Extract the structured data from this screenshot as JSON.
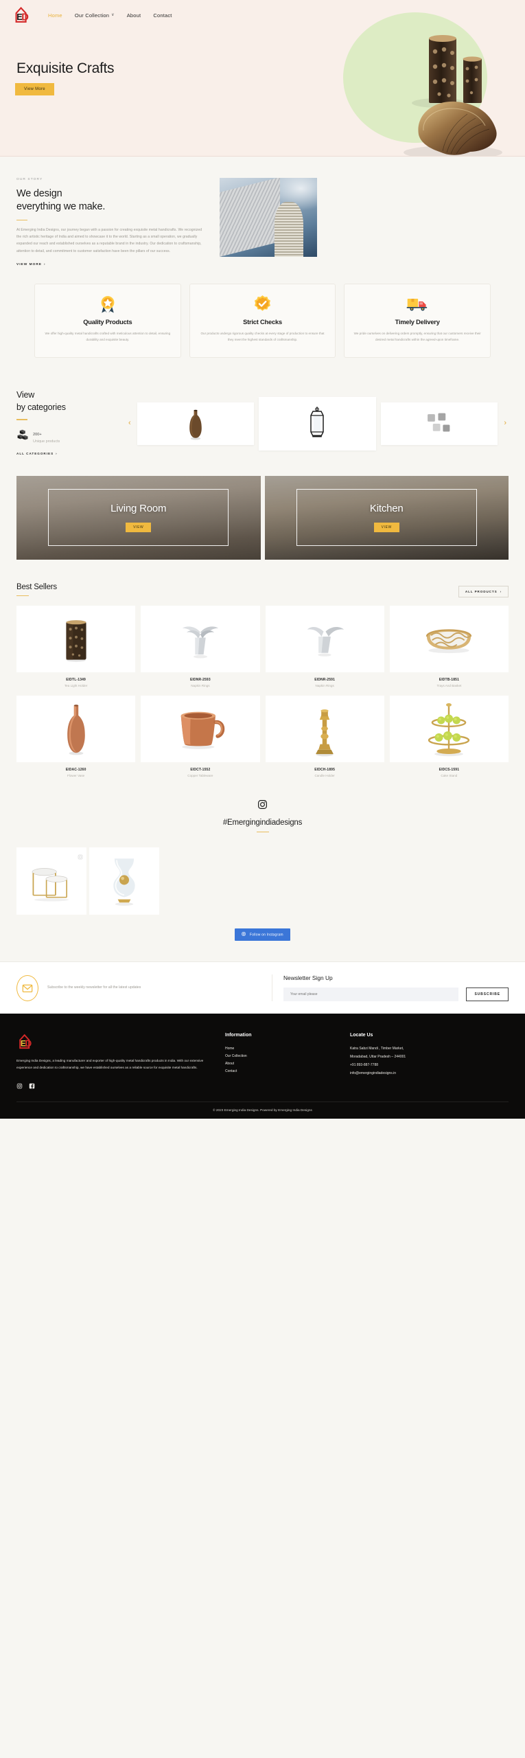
{
  "header": {
    "logo_alt": "EID Emerging India Designs",
    "nav": [
      {
        "label": "Home",
        "active": true,
        "has_caret": false
      },
      {
        "label": "Our Collection",
        "active": false,
        "has_caret": true
      },
      {
        "label": "About",
        "active": false,
        "has_caret": false
      },
      {
        "label": "Contact",
        "active": false,
        "has_caret": false
      }
    ],
    "caret": "∨"
  },
  "hero": {
    "title": "Exquisite Crafts",
    "cta": "View More",
    "bg_color": "#f9efe9",
    "blob_color": "#ddecc4",
    "accent": "#f0b93f"
  },
  "story": {
    "eyebrow": "OUR STORY",
    "heading_line1": "We design",
    "heading_line2": "everything we make.",
    "paragraph": "At Emerging India Designs, our journey began with a passion for creating exquisite metal handicrafts. We recognized the rich artistic heritage of India and aimed to showcase it to the world. Starting as a small operation, we gradually expanded our reach and established ourselves as a reputable brand in the industry. Our dedication to craftsmanship, attention to detail, and commitment to customer satisfaction have been the pillars of our success.",
    "link": "VIEW MORE",
    "link_arrow": "›"
  },
  "features": [
    {
      "icon": "medal-icon",
      "title": "Quality Products",
      "desc": "We offer high-quality metal handicrafts crafted with meticulous attention to detail, ensuring durability and exquisite beauty."
    },
    {
      "icon": "verified-badge-icon",
      "title": "Strict Checks",
      "desc": "Our products undergo rigorous quality checks at every stage of production to ensure that they meet the highest standards of craftsmanship."
    },
    {
      "icon": "delivery-truck-icon",
      "title": "Timely Delivery",
      "desc": "We pride ourselves on delivering orders promptly, ensuring that our customers receive their desired metal handicrafts within the agreed-upon timeframe."
    }
  ],
  "categories": {
    "heading_line1": "View",
    "heading_line2": "by categories",
    "stat_number": "200+",
    "stat_label": "Unique products",
    "all_link": "ALL CATEGORIES",
    "all_link_arrow": "›",
    "prev_arrow": "‹",
    "next_arrow": "›",
    "slides": [
      "vase-thumb",
      "lantern-thumb",
      "napkin-rings-thumb"
    ]
  },
  "rooms": [
    {
      "title": "Living Room",
      "cta": "VIEW"
    },
    {
      "title": "Kitchen",
      "cta": "VIEW"
    }
  ],
  "best_sellers": {
    "title": "Best Sellers",
    "all_button": "ALL PRODUCTS",
    "all_button_arrow": "›",
    "products": [
      {
        "code": "EIDTL-1349",
        "name": "Tea Light Holder"
      },
      {
        "code": "EIDNR-2593",
        "name": "Napkin Rings"
      },
      {
        "code": "EIDNR-2591",
        "name": "Napkin Rings"
      },
      {
        "code": "EIDTB-1851",
        "name": "Trays And Basket"
      },
      {
        "code": "EIDAC-1260",
        "name": "Flower Vase"
      },
      {
        "code": "EIDCT-1552",
        "name": "Copper Tableware"
      },
      {
        "code": "EIDCH-1895",
        "name": "Candle Holder"
      },
      {
        "code": "EIDCS-1591",
        "name": "Cake Stand"
      }
    ]
  },
  "instagram": {
    "hashtag": "#Emergingindiadesigns",
    "follow_button": "Follow on Instagram",
    "tiles": [
      "nesting-tables-photo",
      "crystal-vase-photo"
    ]
  },
  "newsletter": {
    "subtext": "Subscribe to the weekly newsletter for all the latest updates",
    "heading": "Newsletter Sign Up",
    "input_value": "",
    "input_placeholder": "Your email please",
    "button": "SUBSCRIBE"
  },
  "footer": {
    "description": "Emerging India Designs, a leading manufacturer and exporter of high-quality metal handicrafts products in India. With our extensive experience and dedication to craftsmanship, we have established ourselves as a reliable source for exquisite metal handicrafts.",
    "social": [
      "instagram-icon",
      "facebook-icon"
    ],
    "information_title": "Information",
    "information_links": [
      "Home",
      "Our Collection",
      "About",
      "Contact"
    ],
    "locate_title": "Locate Us",
    "address_line1": "Katra Sabzi Mandi , Timber Market,",
    "address_line2": "Moradabad, Uttar Pradesh – 244001",
    "phone": "+91 893-887-7788",
    "email": "info@emergingindiadesigns.in",
    "copyright": "© 2023 Emerging India Designs. Powered by Emerging India Designs"
  }
}
